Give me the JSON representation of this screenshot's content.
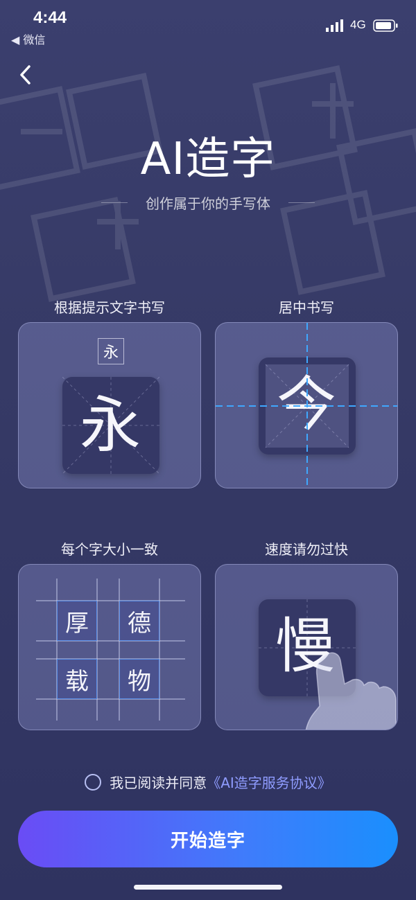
{
  "status": {
    "time": "4:44",
    "back_app": "◀ 微信",
    "network": "4G"
  },
  "header": {
    "title": "AI造字",
    "subtitle": "创作属于你的手写体"
  },
  "tips": [
    {
      "label": "根据提示文字书写",
      "hint_char": "永",
      "char": "永"
    },
    {
      "label": "居中书写",
      "char": "今"
    },
    {
      "label": "每个字大小一致",
      "chars": [
        "厚",
        "德",
        "载",
        "物"
      ]
    },
    {
      "label": "速度请勿过快",
      "char": "慢"
    }
  ],
  "agreement": {
    "text": "我已阅读并同意",
    "link": "《AI造字服务协议》",
    "checked": false
  },
  "start_button": {
    "label": "开始造字"
  },
  "colors": {
    "accent_start": "#6a4cf5",
    "accent_end": "#1a8ffd",
    "link": "#8f9cff",
    "guide_blue": "#3fa8ff"
  }
}
